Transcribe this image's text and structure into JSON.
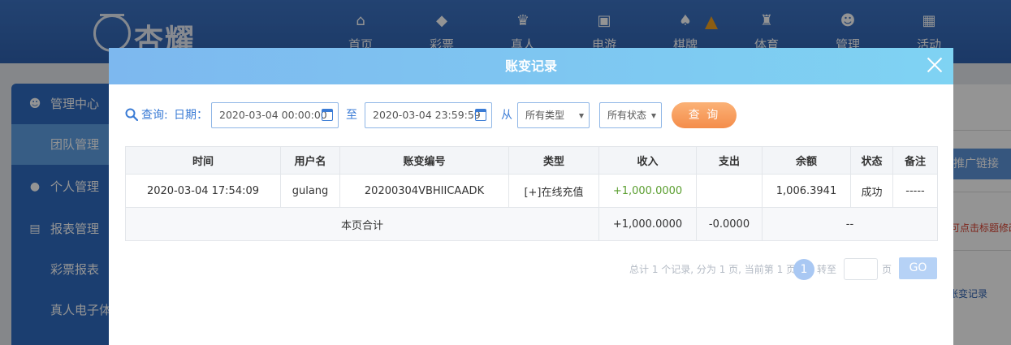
{
  "brand": {
    "logo_text": "杏耀"
  },
  "nav": {
    "items": [
      {
        "label": "首页",
        "icon": "home-icon",
        "glyph": "⌂"
      },
      {
        "label": "彩票",
        "icon": "lottery-icon",
        "glyph": "◆"
      },
      {
        "label": "真人",
        "icon": "live-casino-icon",
        "glyph": "♛"
      },
      {
        "label": "电游",
        "icon": "slot-icon",
        "glyph": "▣"
      },
      {
        "label": "棋牌",
        "icon": "cards-icon",
        "glyph": "♠"
      },
      {
        "label": "体育",
        "icon": "trophy-icon",
        "glyph": "♜"
      },
      {
        "label": "管理",
        "icon": "users-icon",
        "glyph": "☻"
      },
      {
        "label": "活动",
        "icon": "gift-icon",
        "glyph": "▦"
      }
    ]
  },
  "sidebar": {
    "items": [
      {
        "label": "管理中心",
        "icon": "users-icon",
        "glyph": "☻"
      },
      {
        "label": "团队管理",
        "icon": "",
        "glyph": ""
      },
      {
        "label": "个人管理",
        "icon": "user-icon",
        "glyph": "●"
      },
      {
        "label": "报表管理",
        "icon": "report-icon",
        "glyph": "▤"
      },
      {
        "label": "彩票报表",
        "icon": "",
        "glyph": ""
      },
      {
        "label": "真人电子体",
        "icon": "",
        "glyph": ""
      }
    ]
  },
  "background_fragments": {
    "promo": "推广链接",
    "hint": "可点击标题修改",
    "link": "账变记录"
  },
  "modal": {
    "title": "账变记录",
    "filter": {
      "query_label": "查询:",
      "date_label": "日期：",
      "start_date": "2020-03-04 00:00:00",
      "to_label": "至",
      "end_date": "2020-03-04 23:59:59",
      "from_label": "从",
      "type_select": "所有类型",
      "status_select": "所有状态",
      "query_button": "查 询"
    },
    "table": {
      "headers": [
        "时间",
        "用户名",
        "账变编号",
        "类型",
        "收入",
        "支出",
        "余额",
        "状态",
        "备注"
      ],
      "rows": [
        [
          "2020-03-04 17:54:09",
          "gulang",
          "20200304VBHIICAADK",
          "[+]在线充值",
          "+1,000.0000",
          "",
          "1,006.3941",
          "成功",
          "-----"
        ]
      ],
      "summary": {
        "label": "本页合计",
        "income": "+1,000.0000",
        "expense": "-0.0000",
        "rest": "--"
      }
    },
    "pager": {
      "info": "总计 1 个记录, 分为 1 页, 当前第 1 页",
      "current": "1",
      "goto_label": "转至",
      "page_label": "页",
      "go_button": "GO"
    }
  },
  "colors": {
    "accent": "#3a7bd5",
    "income_green": "#5a9e2f",
    "query_button": "#f48c4a",
    "header_gradient_start": "#7db8ef",
    "header_gradient_end": "#7fd3f3"
  }
}
